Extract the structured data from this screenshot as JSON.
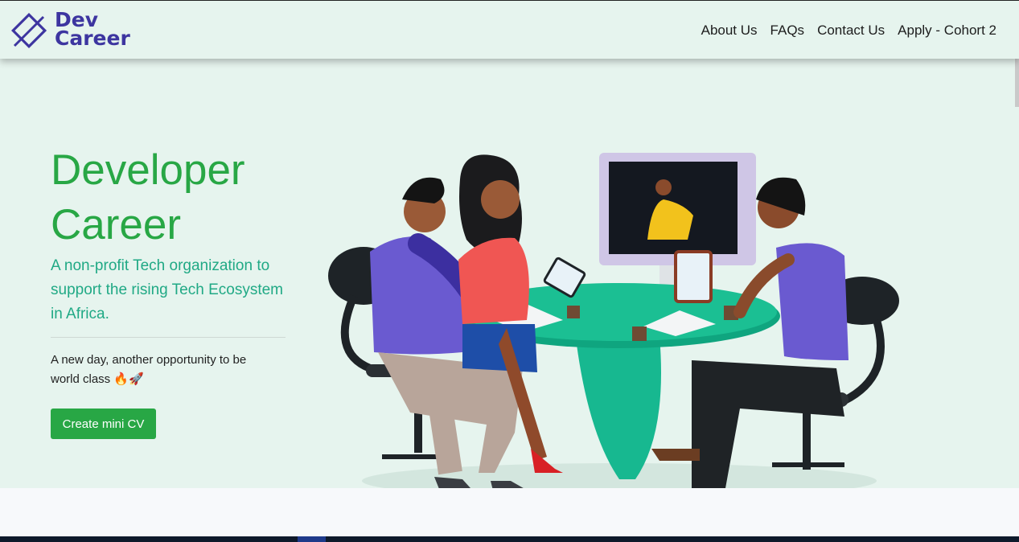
{
  "brand": {
    "line1": "Dev",
    "line2": "Career",
    "color": "#3d35a0",
    "icon": "diamond-logo-icon"
  },
  "nav": [
    {
      "label": "About Us"
    },
    {
      "label": "FAQs"
    },
    {
      "label": "Contact Us"
    },
    {
      "label": "Apply - Cohort 2"
    }
  ],
  "hero": {
    "title_line1": "Developer",
    "title_line2": "Career",
    "subtitle": "A non-profit Tech organization to support the rising Tech Ecosystem in Africa.",
    "tagline": "A new day, another opportunity to be world class 🔥🚀",
    "cta_label": "Create mini CV",
    "accent_color": "#28a745",
    "background_color": "#e6f4ee"
  },
  "illustration": {
    "icon": "team-meeting-illustration"
  }
}
